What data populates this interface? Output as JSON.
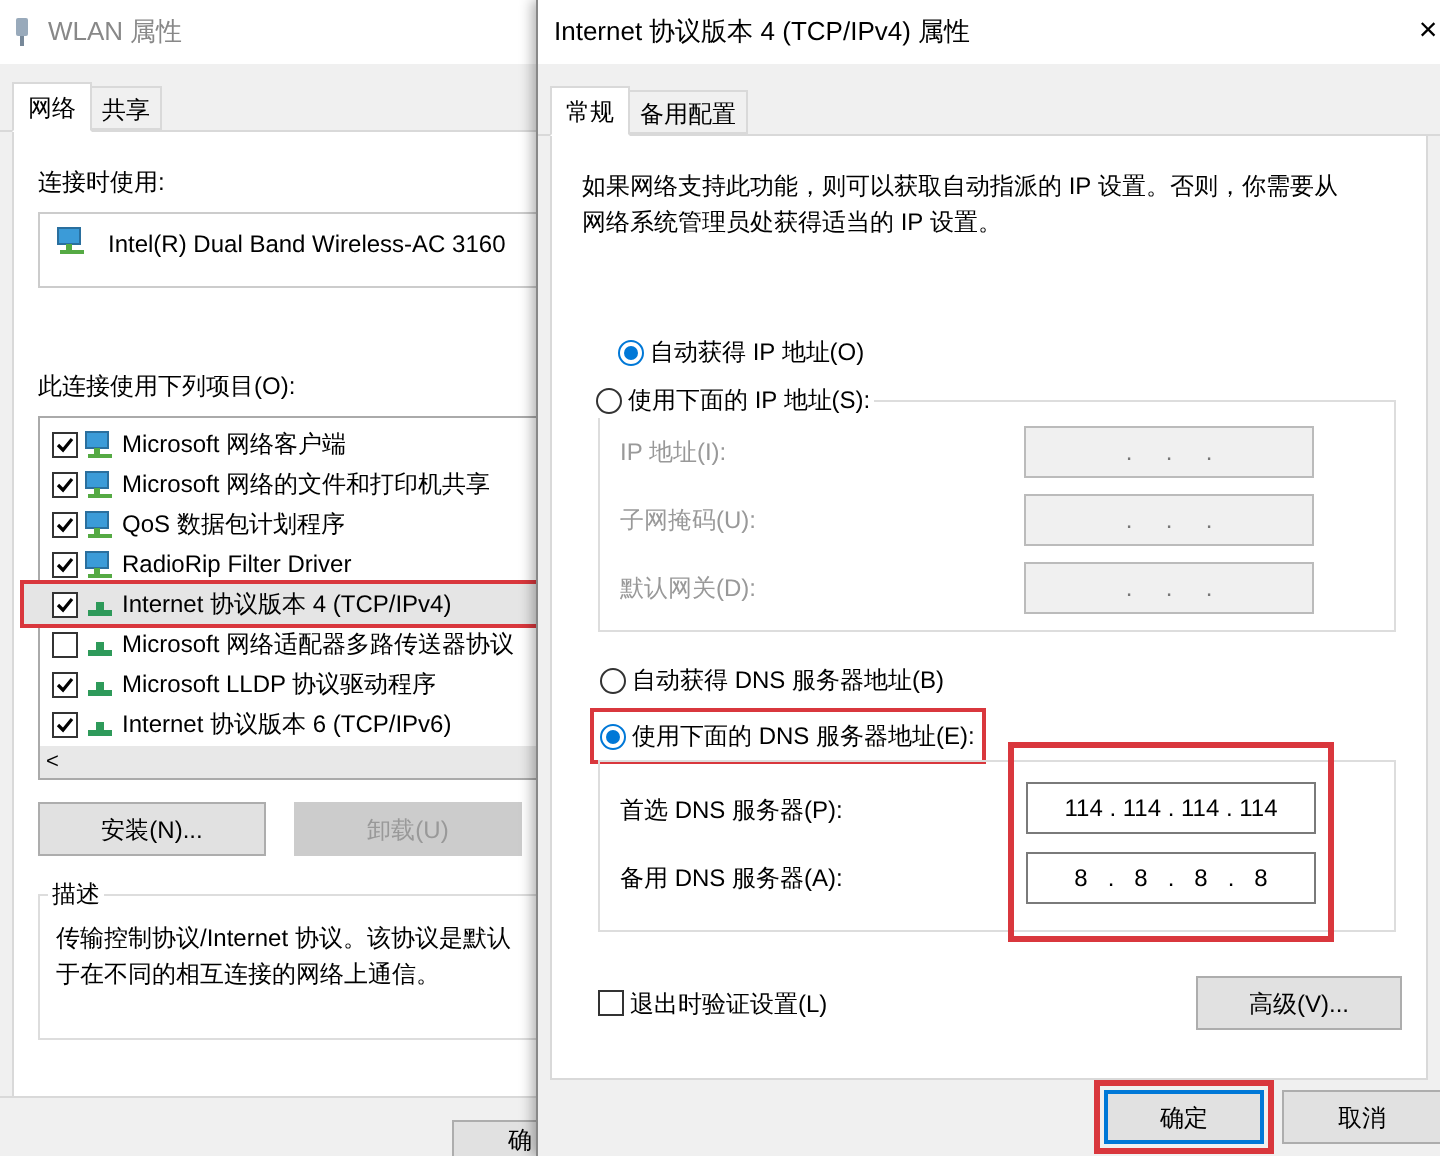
{
  "left_window": {
    "title": "WLAN 属性",
    "tabs": [
      {
        "label": "网络",
        "selected": true
      },
      {
        "label": "共享",
        "selected": false
      }
    ],
    "connect_using_label": "连接时使用:",
    "adapter": "Intel(R) Dual Band Wireless-AC 3160",
    "items_label": "此连接使用下列项目(O):",
    "items": [
      {
        "label": "Microsoft 网络客户端",
        "kind": "client",
        "checked": true,
        "selected": false,
        "highlighted": false
      },
      {
        "label": "Microsoft 网络的文件和打印机共享",
        "kind": "client",
        "checked": true,
        "selected": false,
        "highlighted": false
      },
      {
        "label": "QoS 数据包计划程序",
        "kind": "client",
        "checked": true,
        "selected": false,
        "highlighted": false
      },
      {
        "label": "RadioRip Filter Driver",
        "kind": "client",
        "checked": true,
        "selected": false,
        "highlighted": false
      },
      {
        "label": "Internet 协议版本 4 (TCP/IPv4)",
        "kind": "protocol",
        "checked": true,
        "selected": true,
        "highlighted": true
      },
      {
        "label": "Microsoft 网络适配器多路传送器协议",
        "kind": "protocol",
        "checked": false,
        "selected": false,
        "highlighted": false
      },
      {
        "label": "Microsoft LLDP 协议驱动程序",
        "kind": "protocol",
        "checked": true,
        "selected": false,
        "highlighted": false
      },
      {
        "label": "Internet 协议版本 6 (TCP/IPv6)",
        "kind": "protocol",
        "checked": true,
        "selected": false,
        "highlighted": false
      }
    ],
    "scroll_left": "<",
    "buttons": [
      {
        "label": "安装(N)...",
        "disabled": false
      },
      {
        "label": "卸载(U)",
        "disabled": true
      }
    ],
    "description": {
      "title": "描述",
      "line_1": "传输控制协议/Internet 协议。该协议是默认",
      "line_2": "于在不同的相互连接的网络上通信。"
    },
    "ok_button": "确"
  },
  "dialog": {
    "title": "Internet 协议版本 4 (TCP/IPv4) 属性",
    "close": "×",
    "tabs": [
      {
        "label": "常规",
        "selected": true
      },
      {
        "label": "备用配置",
        "selected": false
      }
    ],
    "intro": "如果网络支持此功能，则可以获取自动指派的 IP 设置。否则，你需要从网络系统管理员处获得适当的 IP 设置。",
    "ip_options": [
      {
        "label": "自动获得 IP 地址(O)",
        "selected": true
      },
      {
        "label": "使用下面的 IP 地址(S):",
        "selected": false
      }
    ],
    "ip_fields": [
      {
        "label": "IP 地址(I):",
        "value": ".     .     .",
        "disabled": true
      },
      {
        "label": "子网掩码(U):",
        "value": ".     .     .",
        "disabled": true
      },
      {
        "label": "默认网关(D):",
        "value": ".     .     .",
        "disabled": true
      }
    ],
    "dns_options": [
      {
        "label": "自动获得 DNS 服务器地址(B)",
        "selected": false,
        "highlighted": false
      },
      {
        "label": "使用下面的 DNS 服务器地址(E):",
        "selected": true,
        "highlighted": true
      }
    ],
    "dns_fields_highlighted": true,
    "dns_fields": [
      {
        "label": "首选 DNS 服务器(P):",
        "value": "114 . 114 . 114 . 114",
        "disabled": false
      },
      {
        "label": "备用 DNS 服务器(A):",
        "value": "8   .   8   .   8   .   8",
        "disabled": false
      }
    ],
    "validate": {
      "label": "退出时验证设置(L)",
      "checked": false
    },
    "advanced_button": "高级(V)...",
    "buttons": [
      {
        "label": "确定",
        "highlighted": true
      },
      {
        "label": "取消",
        "highlighted": false
      }
    ]
  }
}
